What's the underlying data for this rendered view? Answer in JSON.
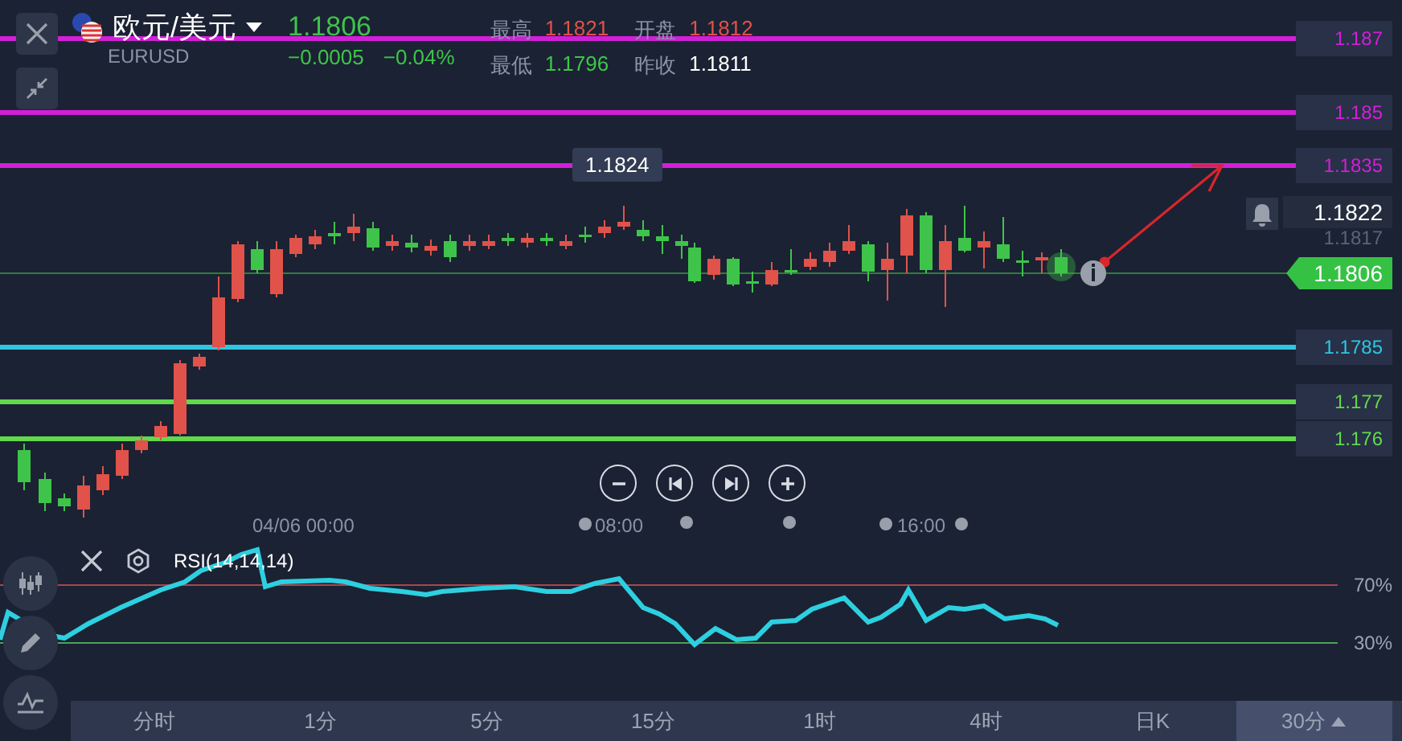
{
  "instrument": {
    "name": "欧元/美元",
    "symbol": "EURUSD",
    "price": "1.1806",
    "change": "−0.0005",
    "change_percent": "−0.04%",
    "stats": [
      {
        "label": "最高",
        "value": "1.1821",
        "color": "#e0524a"
      },
      {
        "label": "开盘",
        "value": "1.1812",
        "color": "#e0524a"
      },
      {
        "label": "最低",
        "value": "1.1796",
        "color": "#3ec44a"
      },
      {
        "label": "昨收",
        "value": "1.1811",
        "color": "#ffffff"
      }
    ]
  },
  "level_lines": [
    {
      "label": "1.187",
      "color": "#d21fd8"
    },
    {
      "label": "1.185",
      "color": "#d21fd8"
    },
    {
      "label": "1.1835",
      "color": "#d21fd8"
    },
    {
      "label": "1.1785",
      "color": "#2ec6e2"
    },
    {
      "label": "1.177",
      "color": "#62d84c"
    },
    {
      "label": "1.176",
      "color": "#62d84c"
    }
  ],
  "price_tags": {
    "current": "1.1806",
    "alert": "1.1822",
    "previous": "1.1817",
    "high_marker": "1.1824"
  },
  "time_labels": [
    "04/06 00:00",
    "08:00",
    "16:00"
  ],
  "rsi": {
    "title": "RSI(14,14,14)",
    "upper": "70%",
    "lower": "30%"
  },
  "timeframes": [
    {
      "label": "分时",
      "selected": false
    },
    {
      "label": "1分",
      "selected": false
    },
    {
      "label": "5分",
      "selected": false
    },
    {
      "label": "15分",
      "selected": false
    },
    {
      "label": "1时",
      "selected": false
    },
    {
      "label": "4时",
      "selected": false
    },
    {
      "label": "日K",
      "selected": false
    },
    {
      "label": "30分",
      "selected": true
    }
  ]
}
